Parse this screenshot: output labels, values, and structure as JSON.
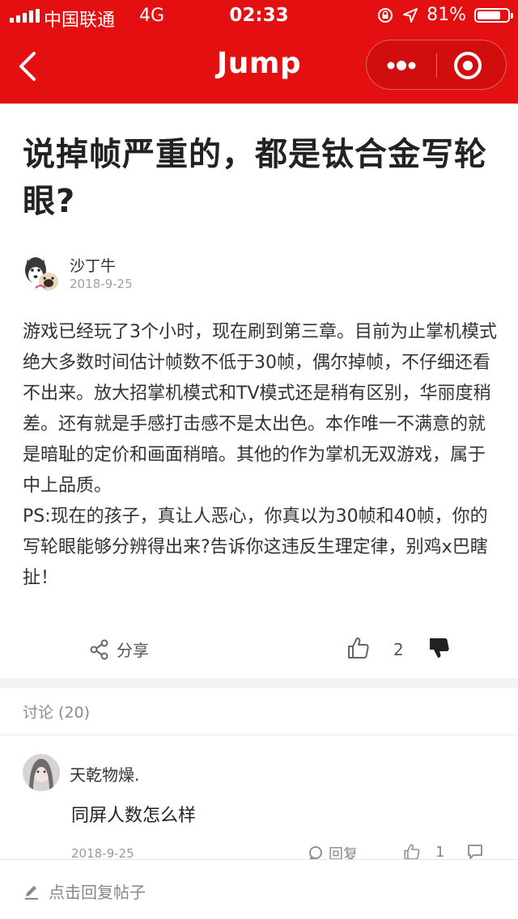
{
  "status": {
    "carrier": "中国联通",
    "network": "4G",
    "time": "02:33",
    "battery": "81%",
    "battery_level": 0.81
  },
  "nav": {
    "title": "Jump"
  },
  "post": {
    "title": "说掉帧严重的，都是钛合金写轮眼?",
    "author": "沙丁牛",
    "date": "2018-9-25",
    "paragraphs": [
      "游戏已经玩了3个小时，现在刷到第三章。目前为止掌机模式绝大多数时间估计帧数不低于30帧，偶尔掉帧，不仔细还看不出来。放大招掌机模式和TV模式还是稍有区别，华丽度稍差。还有就是手感打击感不是太出色。本作唯一不满意的就是暗耻的定价和画面稍暗。其他的作为掌机无双游戏，属于中上品质。",
      "PS:现在的孩子，真让人恶心，你真以为30帧和40帧，你的写轮眼能够分辨得出来?告诉你这违反生理定律，别鸡x巴瞎扯！"
    ]
  },
  "actions": {
    "share_label": "分享",
    "like_count": "2"
  },
  "discussion": {
    "header": "讨论 (20)",
    "comments": [
      {
        "name": "天乾物燥.",
        "text": "同屏人数怎么样",
        "date": "2018-9-25",
        "reply_label": "回复",
        "like_count": "1"
      }
    ]
  },
  "footer": {
    "reply_placeholder": "点击回复帖子"
  },
  "colors": {
    "brand": "#e30f10"
  },
  "icons": {
    "back": "chevron-left-icon",
    "more": "more-dots-icon",
    "target": "target-icon",
    "share": "share-icon",
    "like": "thumbs-up-icon",
    "dislike": "thumbs-down-icon",
    "reply": "comment-bubble-icon",
    "edit": "pencil-icon"
  }
}
